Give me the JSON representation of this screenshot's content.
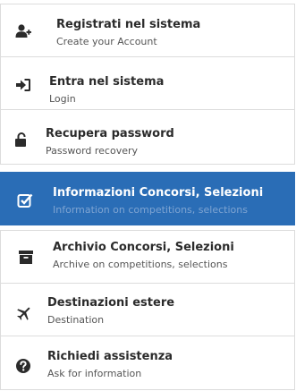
{
  "menu": {
    "items": [
      {
        "title": "Registrati nel sistema",
        "subtitle": "Create your Account",
        "icon": "add-user-icon",
        "active": false
      },
      {
        "title": "Entra nel sistema",
        "subtitle": "Login",
        "icon": "sign-in-icon",
        "active": false
      },
      {
        "title": "Recupera password",
        "subtitle": "Password recovery",
        "icon": "unlock-icon",
        "active": false
      },
      {
        "title": "Informazioni Concorsi, Selezioni",
        "subtitle": "Information on competitions, selections",
        "icon": "checkbox-icon",
        "active": true
      },
      {
        "title": "Archivio Concorsi, Selezioni",
        "subtitle": "Archive on competitions, selections",
        "icon": "archive-icon",
        "active": false
      },
      {
        "title": "Destinazioni estere",
        "subtitle": "Destination",
        "icon": "plane-icon",
        "active": false
      },
      {
        "title": "Richiedi assistenza",
        "subtitle": "Ask for information",
        "icon": "question-icon",
        "active": false
      }
    ]
  },
  "colors": {
    "active_background": "#2a6db6",
    "active_subtitle": "#7ea4d2",
    "text": "#2b2b2b",
    "border": "#dcdcdc"
  }
}
